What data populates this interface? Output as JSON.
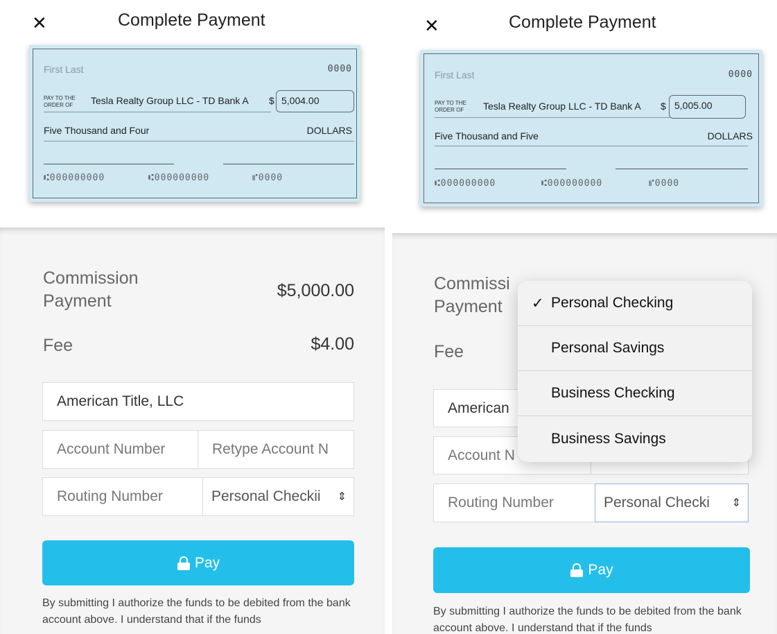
{
  "screens": [
    {
      "title": "Complete Payment",
      "close_glyph": "✕",
      "check": {
        "name": "First Last",
        "check_number": "0000",
        "pay_to_label_1": "PAY TO THE",
        "pay_to_label_2": "ORDER OF",
        "payee": "Tesla Realty Group LLC - TD Bank A",
        "currency": "$",
        "amount": "5,004.00",
        "amount_words": "Five Thousand and Four",
        "dollars_label": "DOLLARS",
        "micr_routing": "⑆000000000",
        "micr_account": "⑆000000000",
        "micr_check": "⑈0000"
      },
      "summary": {
        "commission_label_1": "Commission",
        "commission_label_2": "Payment",
        "commission_value": "$5,000.00",
        "fee_label": "Fee",
        "fee_value": "$4.00"
      },
      "form": {
        "payee_name": "American Title, LLC",
        "account_number_placeholder": "Account Number",
        "retype_account_placeholder": "Retype Account N",
        "routing_number_placeholder": "Routing Number",
        "account_type_selected": "Personal Checkii"
      },
      "pay_label": "Pay",
      "disclaimer": "By submitting I authorize the funds to be debited from the bank account above. I understand that if the funds"
    },
    {
      "title": "Complete Payment",
      "close_glyph": "✕",
      "check": {
        "name": "First Last",
        "check_number": "0000",
        "pay_to_label_1": "PAY TO THE",
        "pay_to_label_2": "ORDER OF",
        "payee": "Tesla Realty Group LLC - TD Bank A",
        "currency": "$",
        "amount": "5,005.00",
        "amount_words": "Five Thousand and Five",
        "dollars_label": "DOLLARS",
        "micr_routing": "⑆000000000",
        "micr_account": "⑆000000000",
        "micr_check": "⑈0000"
      },
      "summary": {
        "commission_label_1": "Commissi",
        "commission_label_2": "Payment",
        "fee_label": "Fee"
      },
      "form": {
        "payee_name": "American",
        "account_number_placeholder": "Account N",
        "routing_number_placeholder": "Routing Number",
        "account_type_selected": "Personal Checki"
      },
      "pay_label": "Pay",
      "disclaimer": "By submitting I authorize the funds to be debited from the bank account above. I understand that if the funds"
    }
  ],
  "account_type_dropdown": {
    "checkmark": "✓",
    "options": [
      "Personal Checking",
      "Personal Savings",
      "Business Checking",
      "Business Savings"
    ],
    "selected": "Personal Checking"
  },
  "colors": {
    "check_background": "#cfe8f2",
    "pay_button": "#23bfea",
    "panel_background": "#f5f5f5"
  },
  "icons": [
    "close-icon",
    "lock-icon",
    "select-arrows-icon",
    "checkmark-icon"
  ]
}
